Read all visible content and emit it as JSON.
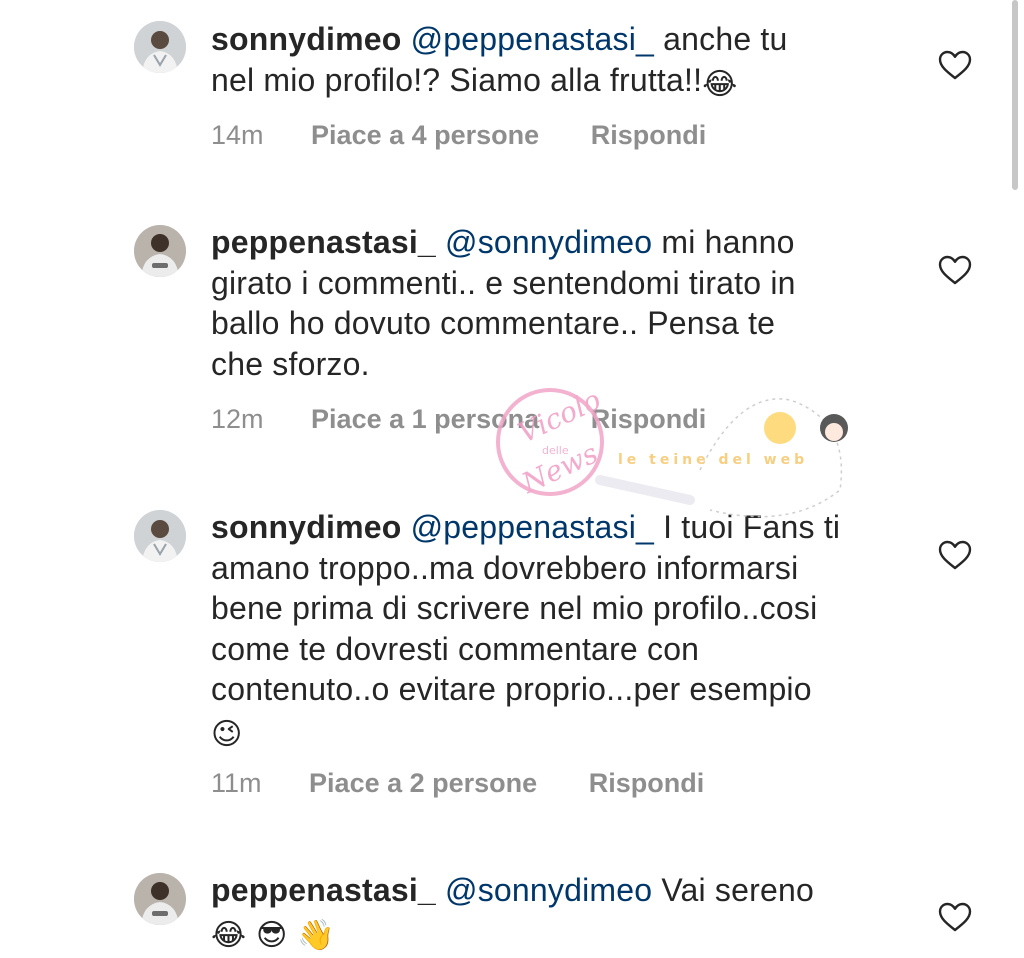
{
  "comments": [
    {
      "username": "sonnydimeo",
      "mention": "@peppenastasi_",
      "line1_rest": "anche tu",
      "line2": "nel mio profilo!? Siamo alla frutta!!",
      "emoji": "😂",
      "time": "14m",
      "likes": "Piace a 4 persone",
      "reply": "Rispondi"
    },
    {
      "username": "peppenastasi_",
      "mention": "@sonnydimeo",
      "line1_rest": "mi hanno",
      "line2": "girato i commenti.. e sentendomi tirato in",
      "line3": "ballo ho dovuto commentare.. Pensa te",
      "line4": "che sforzo.",
      "time": "12m",
      "likes": "Piace a 1 persona",
      "reply": "Rispondi"
    },
    {
      "username": "sonnydimeo",
      "mention": "@peppenastasi_",
      "line1_rest": "I tuoi Fans ti",
      "line2": "amano troppo..ma dovrebbero informarsi",
      "line3": "bene prima di scrivere nel mio profilo..cosi",
      "line4": "come te dovresti commentare con",
      "line5": "contenuto..o evitare proprio...per esempio",
      "emoji": "😉",
      "time": "11m",
      "likes": "Piace a 2 persone",
      "reply": "Rispondi"
    },
    {
      "username": "peppenastasi_",
      "mention": "@sonnydimeo",
      "line1_rest": "Vai sereno",
      "emojis": "😂 😎 👋"
    }
  ],
  "watermark": {
    "logo_text_1": "Vicolo",
    "logo_text_2": "delle",
    "logo_text_3": "News",
    "banner_text": "le teine del web"
  },
  "icons": {
    "like": "heart-outline-icon"
  },
  "colors": {
    "text": "#262626",
    "mention": "#00376b",
    "meta": "#8e8e8e"
  }
}
